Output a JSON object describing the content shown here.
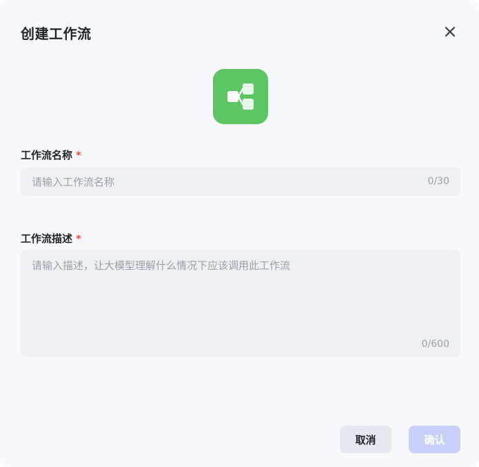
{
  "dialog": {
    "title": "创建工作流",
    "close_icon": "close-icon"
  },
  "app_icon": {
    "name": "workflow-icon",
    "color": "#5cc463"
  },
  "fields": {
    "name": {
      "label": "工作流名称",
      "required_mark": "*",
      "placeholder": "请输入工作流名称",
      "value": "",
      "counter": "0/30"
    },
    "description": {
      "label": "工作流描述",
      "required_mark": "*",
      "placeholder": "请输入描述，让大模型理解什么情况下应该调用此工作流",
      "value": "",
      "counter": "0/600"
    }
  },
  "buttons": {
    "cancel_label": "取消",
    "confirm_label": "确认"
  },
  "colors": {
    "background": "#f7f8fc",
    "input_bg": "#eff0f4",
    "required": "#f24a3a",
    "confirm_disabled": "#c9cffb",
    "cancel_bg": "#e6e8f0"
  }
}
